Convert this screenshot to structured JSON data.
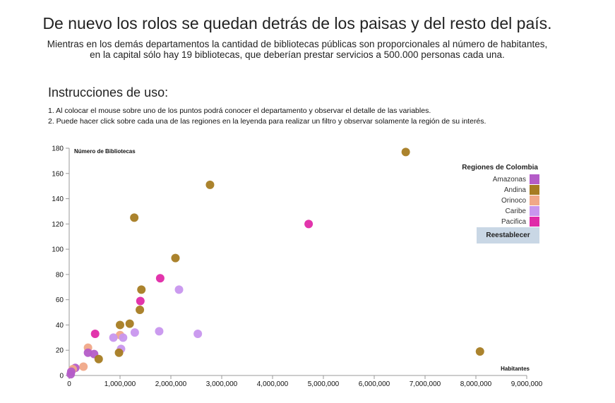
{
  "header": {
    "title": "De nuevo los rolos se quedan detrás de los paisas y del resto del país.",
    "subtitle_line1": "Mientras en los demás departamentos la cantidad de bibliotecas públicas son proporcionales al número de habitantes,",
    "subtitle_line2": "en la capital sólo hay 19 bibliotecas, que deberían prestar servicios a 500.000 personas cada una."
  },
  "instructions": {
    "title": "Instrucciones de uso:",
    "step1": "1. Al colocar el mouse sobre uno de los puntos podrá conocer el departamento y observar el detalle de las variables.",
    "step2": "2. Puede hacer click sobre cada una de las regiones en la leyenda para realizar un filtro y observar solamente la región de su interés."
  },
  "legend": {
    "title": "Regiones de Colombia",
    "items": [
      {
        "label": "Amazonas",
        "color": "#b45cc8"
      },
      {
        "label": "Andina",
        "color": "#a67c22"
      },
      {
        "label": "Orinoco",
        "color": "#f0a888"
      },
      {
        "label": "Caribe",
        "color": "#c896ee"
      },
      {
        "label": "Pacifica",
        "color": "#e02aa8"
      }
    ],
    "reset_label": "Reestablecer"
  },
  "chart_data": {
    "type": "scatter",
    "xlabel": "Habitantes",
    "ylabel": "Número de Bibliotecas",
    "xlim": [
      0,
      9000000
    ],
    "ylim": [
      0,
      180
    ],
    "x_ticks": [
      0,
      1000000,
      2000000,
      3000000,
      4000000,
      5000000,
      6000000,
      7000000,
      8000000,
      9000000
    ],
    "x_tick_labels": [
      "0",
      "1,000,000",
      "2,000,000",
      "3,000,000",
      "4,000,000",
      "5,000,000",
      "6,000,000",
      "7,000,000",
      "8,000,000",
      "9,000,000"
    ],
    "y_ticks": [
      0,
      20,
      40,
      60,
      80,
      100,
      120,
      140,
      160,
      180
    ],
    "y_tick_labels": [
      "0",
      "20",
      "40",
      "60",
      "80",
      "100",
      "120",
      "140",
      "160",
      "180"
    ],
    "points": [
      {
        "x": 6620000,
        "y": 177,
        "region": "Andina"
      },
      {
        "x": 2770000,
        "y": 151,
        "region": "Andina"
      },
      {
        "x": 1280000,
        "y": 125,
        "region": "Andina"
      },
      {
        "x": 4710000,
        "y": 120,
        "region": "Pacifica"
      },
      {
        "x": 2090000,
        "y": 93,
        "region": "Andina"
      },
      {
        "x": 1790000,
        "y": 77,
        "region": "Pacifica"
      },
      {
        "x": 1420000,
        "y": 68,
        "region": "Andina"
      },
      {
        "x": 2160000,
        "y": 68,
        "region": "Caribe"
      },
      {
        "x": 1400000,
        "y": 59,
        "region": "Pacifica"
      },
      {
        "x": 1390000,
        "y": 52,
        "region": "Andina"
      },
      {
        "x": 1190000,
        "y": 41,
        "region": "Andina"
      },
      {
        "x": 1000000,
        "y": 40,
        "region": "Andina"
      },
      {
        "x": 1770000,
        "y": 35,
        "region": "Caribe"
      },
      {
        "x": 1290000,
        "y": 34,
        "region": "Caribe"
      },
      {
        "x": 510000,
        "y": 33,
        "region": "Pacifica"
      },
      {
        "x": 2530000,
        "y": 33,
        "region": "Caribe"
      },
      {
        "x": 1000000,
        "y": 32,
        "region": "Orinoco"
      },
      {
        "x": 870000,
        "y": 30,
        "region": "Caribe"
      },
      {
        "x": 1060000,
        "y": 30,
        "region": "Caribe"
      },
      {
        "x": 370000,
        "y": 22,
        "region": "Orinoco"
      },
      {
        "x": 1020000,
        "y": 21,
        "region": "Caribe"
      },
      {
        "x": 8080000,
        "y": 19,
        "region": "Andina"
      },
      {
        "x": 370000,
        "y": 18,
        "region": "Amazonas"
      },
      {
        "x": 980000,
        "y": 18,
        "region": "Andina"
      },
      {
        "x": 490000,
        "y": 17,
        "region": "Amazonas"
      },
      {
        "x": 580000,
        "y": 13,
        "region": "Andina"
      },
      {
        "x": 280000,
        "y": 7,
        "region": "Orinoco"
      },
      {
        "x": 120000,
        "y": 6,
        "region": "Amazonas"
      },
      {
        "x": 70000,
        "y": 5,
        "region": "Orinoco"
      },
      {
        "x": 40000,
        "y": 3,
        "region": "Amazonas"
      },
      {
        "x": 30000,
        "y": 1,
        "region": "Amazonas"
      }
    ]
  }
}
